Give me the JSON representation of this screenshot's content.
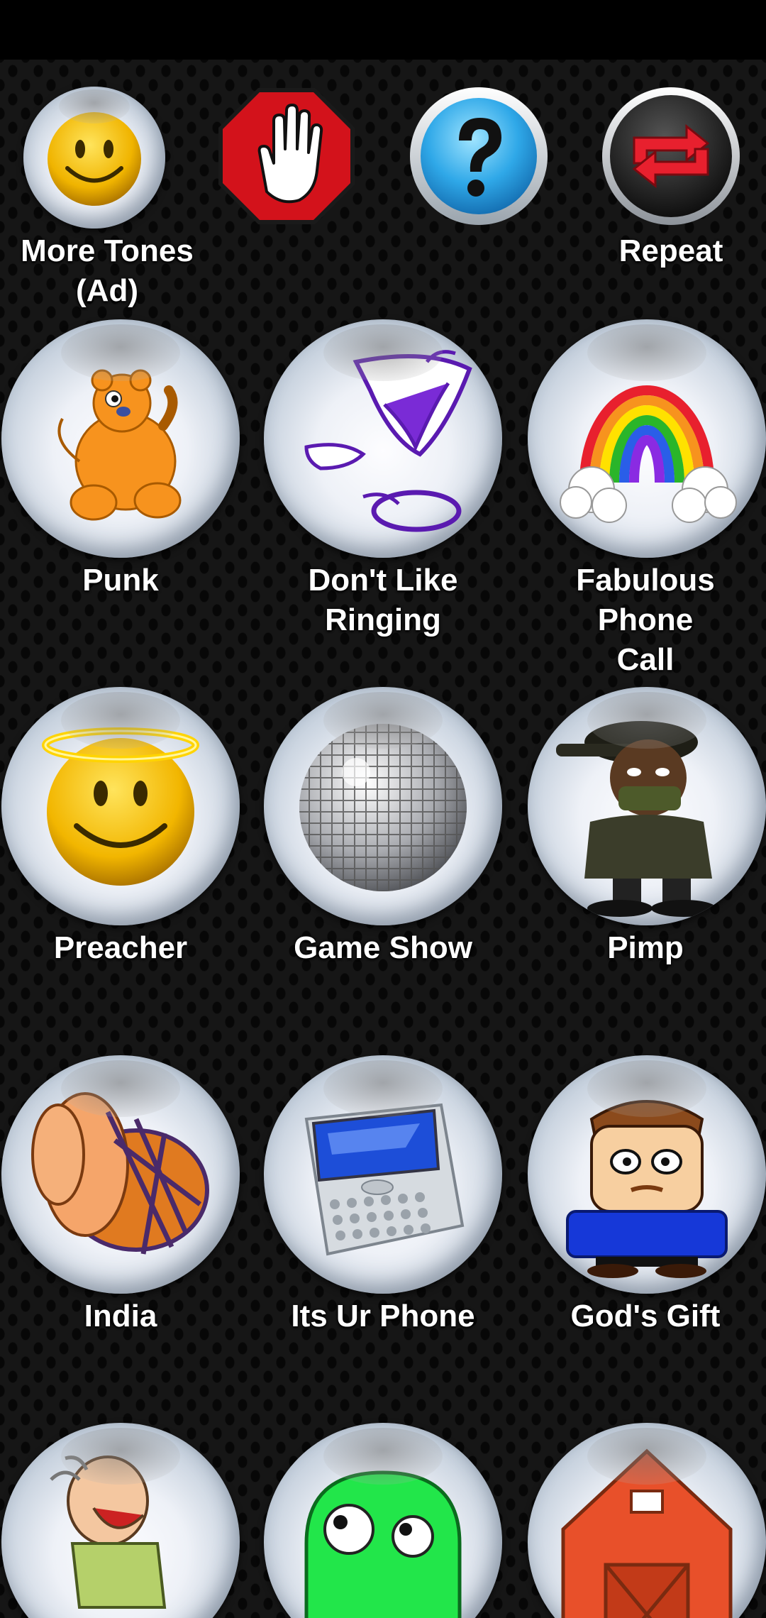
{
  "status_bar": {},
  "toolbar": {
    "more_tones_label": "More Tones\n(Ad)",
    "stop_label": "",
    "help_label": "",
    "repeat_label": "Repeat"
  },
  "tones": [
    {
      "label": "Punk",
      "icon": "orange-bear-icon"
    },
    {
      "label": "Don't Like\nRinging",
      "icon": "laughing-mouth-icon"
    },
    {
      "label": "Fabulous Phone\nCall",
      "icon": "rainbow-icon"
    },
    {
      "label": "Preacher",
      "icon": "angel-smiley-icon"
    },
    {
      "label": "Game Show",
      "icon": "disco-ball-icon"
    },
    {
      "label": "Pimp",
      "icon": "rapper-character-icon"
    },
    {
      "label": "India",
      "icon": "drum-icon"
    },
    {
      "label": "Its Ur Phone",
      "icon": "smartphone-icon"
    },
    {
      "label": "God's Gift",
      "icon": "cartoon-guy-icon"
    },
    {
      "label": "",
      "icon": "laughing-man-icon"
    },
    {
      "label": "",
      "icon": "green-ghost-icon"
    },
    {
      "label": "",
      "icon": "barn-icon"
    }
  ],
  "colors": {
    "background": "#161616",
    "stop_red": "#d3121b",
    "help_blue": "#2fa8e8",
    "repeat_red": "#e8202e",
    "label_text": "#ffffff"
  }
}
